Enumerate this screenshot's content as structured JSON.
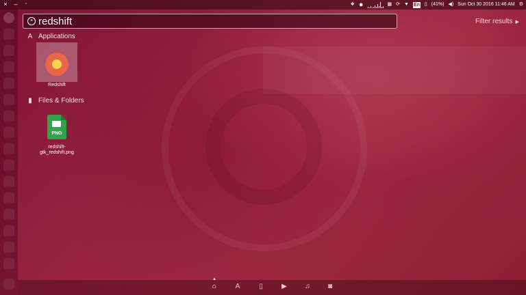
{
  "topbar": {
    "datetime": "Sun Oct 30 2016 11:46 AM",
    "battery_text": "(41%)",
    "keyboard_layout": "En",
    "tray_icons": [
      "dropbox-icon",
      "record-icon",
      "network-graph-icon",
      "cpu-icon",
      "sync-icon",
      "wifi-icon",
      "keyboard-icon",
      "battery-icon",
      "volume-icon",
      "settings-icon"
    ]
  },
  "search": {
    "value": "redshift"
  },
  "filter": {
    "label": "Filter results"
  },
  "sections": {
    "applications": {
      "title": "Applications",
      "items": [
        {
          "label": "Redshift",
          "icon": "lightbulb-icon"
        }
      ]
    },
    "files": {
      "title": "Files & Folders",
      "items": [
        {
          "label_line1": "redshift-",
          "label_line2": "gtk_redshift.png",
          "file_type": "PNG"
        }
      ]
    }
  },
  "lenses": [
    "home-lens-icon",
    "applications-lens-icon",
    "files-lens-icon",
    "video-lens-icon",
    "music-lens-icon",
    "photos-lens-icon"
  ],
  "colors": {
    "accent": "#e9664a",
    "png_icon": "#2fa44a",
    "background": "#95203f"
  }
}
